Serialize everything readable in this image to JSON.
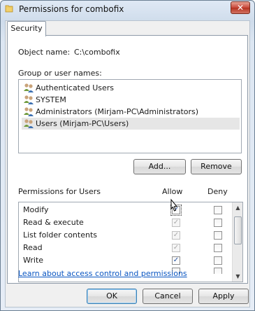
{
  "window": {
    "title": "Permissions for combofix",
    "close_glyph": "✕",
    "icon": "folder-icon"
  },
  "tabs": [
    {
      "label": "Security",
      "active": true
    }
  ],
  "object": {
    "label": "Object name:",
    "value": "C:\\combofix"
  },
  "groups": {
    "label": "Group or user names:",
    "items": [
      {
        "label": "Authenticated Users",
        "selected": false,
        "icon": "users-icon"
      },
      {
        "label": "SYSTEM",
        "selected": false,
        "icon": "users-icon"
      },
      {
        "label": "Administrators (Mirjam-PC\\Administrators)",
        "selected": false,
        "icon": "users-icon"
      },
      {
        "label": "Users (Mirjam-PC\\Users)",
        "selected": true,
        "icon": "users-icon"
      }
    ],
    "add_label": "Add...",
    "remove_label": "Remove"
  },
  "permissions": {
    "label": "Permissions for Users",
    "allow_header": "Allow",
    "deny_header": "Deny",
    "rows": [
      {
        "name": "Modify",
        "allow": true,
        "allow_enabled": true,
        "deny": false
      },
      {
        "name": "Read & execute",
        "allow": true,
        "allow_enabled": false,
        "deny": false
      },
      {
        "name": "List folder contents",
        "allow": true,
        "allow_enabled": false,
        "deny": false
      },
      {
        "name": "Read",
        "allow": true,
        "allow_enabled": false,
        "deny": false
      },
      {
        "name": "Write",
        "allow": true,
        "allow_enabled": true,
        "deny": false
      }
    ]
  },
  "help_link": "Learn about access control and permissions",
  "footer": {
    "ok_label": "OK",
    "cancel_label": "Cancel",
    "apply_label": "Apply"
  },
  "colors": {
    "link": "#0a56c2",
    "selection": "#e6e6e6",
    "close_button": "#c8483a"
  }
}
